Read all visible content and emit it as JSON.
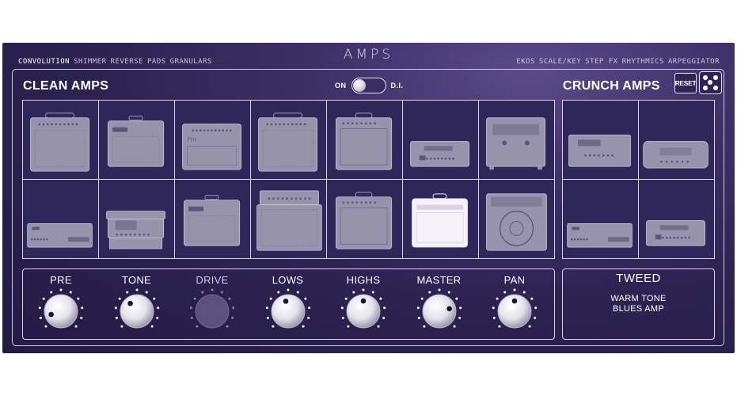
{
  "header": {
    "title": "AMPS",
    "nav_left": [
      "CONVOLUTION",
      "SHIMMER",
      "REVERSE",
      "PADS",
      "GRANULARS"
    ],
    "nav_left_active": "CONVOLUTION",
    "nav_right": [
      "EKOS",
      "SCALE/KEY",
      "STEP FX",
      "RHYTHMICS",
      "ARPEGGIATOR"
    ]
  },
  "clean": {
    "title": "CLEAN AMPS",
    "di_on_label": "ON",
    "di_label": "D.I.",
    "di_state": "on",
    "amps": [
      {
        "style": "combo-tall"
      },
      {
        "style": "combo-grille"
      },
      {
        "style": "combo-low"
      },
      {
        "style": "combo-tall"
      },
      {
        "style": "combo-plain"
      },
      {
        "style": "head-small"
      },
      {
        "style": "combo-feet"
      },
      {
        "style": "head-flat"
      },
      {
        "style": "stack"
      },
      {
        "style": "combo-grille"
      },
      {
        "style": "big-stack"
      },
      {
        "style": "combo-plain"
      },
      {
        "style": "combo-bright",
        "selected": true
      },
      {
        "style": "speaker-round"
      }
    ]
  },
  "crunch": {
    "title": "CRUNCH AMPS",
    "reset_label": "RESET",
    "amps": [
      {
        "style": "head-box"
      },
      {
        "style": "head-wide"
      },
      {
        "style": "head-flat"
      },
      {
        "style": "head-small"
      }
    ]
  },
  "knobs": [
    {
      "label": "PRE",
      "value": 0.1,
      "enabled": true
    },
    {
      "label": "TONE",
      "value": 0.35,
      "enabled": true
    },
    {
      "label": "DRIVE",
      "value": 0.5,
      "enabled": false
    },
    {
      "label": "LOWS",
      "value": 0.45,
      "enabled": true
    },
    {
      "label": "HIGHS",
      "value": 0.5,
      "enabled": true
    },
    {
      "label": "MASTER",
      "value": 0.78,
      "enabled": true
    },
    {
      "label": "PAN",
      "value": 0.5,
      "enabled": true
    }
  ],
  "preset": {
    "name": "TWEED",
    "description": "WARM TONE\nBLUES AMP"
  },
  "colors": {
    "background": "#2b2250",
    "amp_outline": "#a19bb8",
    "amp_selected": "#f0eef5",
    "border": "#d8d2ef"
  }
}
